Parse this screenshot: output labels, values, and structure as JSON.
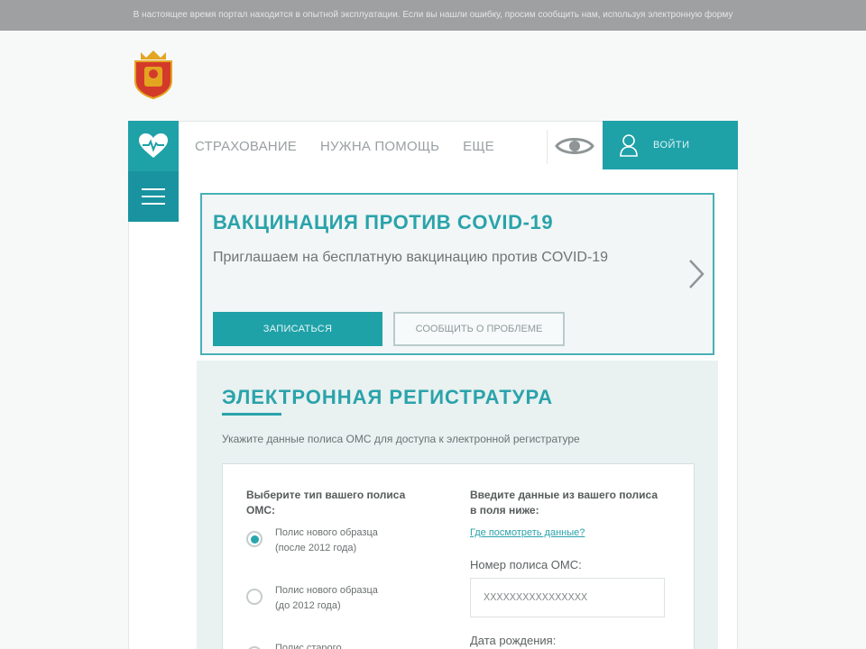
{
  "notice": "В настоящее время портал находится в опытной эксплуатации. Если вы нашли ошибку, просим сообщить нам, используя электронную форму",
  "nav": {
    "items": [
      "СТРАХОВАНИЕ",
      "НУЖНА ПОМОЩЬ",
      "ЕЩЕ"
    ],
    "login_label": "ВОЙТИ"
  },
  "covid": {
    "title": "ВАКЦИНАЦИЯ ПРОТИВ COVID-19",
    "text": "Приглашаем на бесплатную вакцинацию против COVID-19",
    "primary_button": "ЗАПИСАТЬСЯ",
    "secondary_button": "СООБЩИТЬ О ПРОБЛЕМЕ"
  },
  "registry": {
    "title": "ЭЛЕКТРОННАЯ РЕГИСТРАТУРА",
    "hint": "Укажите данные полиса ОМС для доступа к электронной регистратуре",
    "left_title": "Выберите тип вашего полиса ОМС:",
    "options": [
      {
        "label": "Полис нового образца (после 2012 года)",
        "selected": true
      },
      {
        "label": "Полис нового образца (до 2012 года)",
        "selected": false
      },
      {
        "label": "Полис старого",
        "selected": false
      }
    ],
    "right_title": "Введите данные из вашего полиса в поля ниже:",
    "help_link": "Где посмотреть данные?",
    "policy_label": "Номер полиса ОМС:",
    "policy_value": "XXXXXXXXXXXXXXXX",
    "birth_label": "Дата рождения:"
  },
  "colors": {
    "accent": "#1fa1a8",
    "accent_dark": "#1993a0",
    "panel": "#e9f1f1"
  }
}
